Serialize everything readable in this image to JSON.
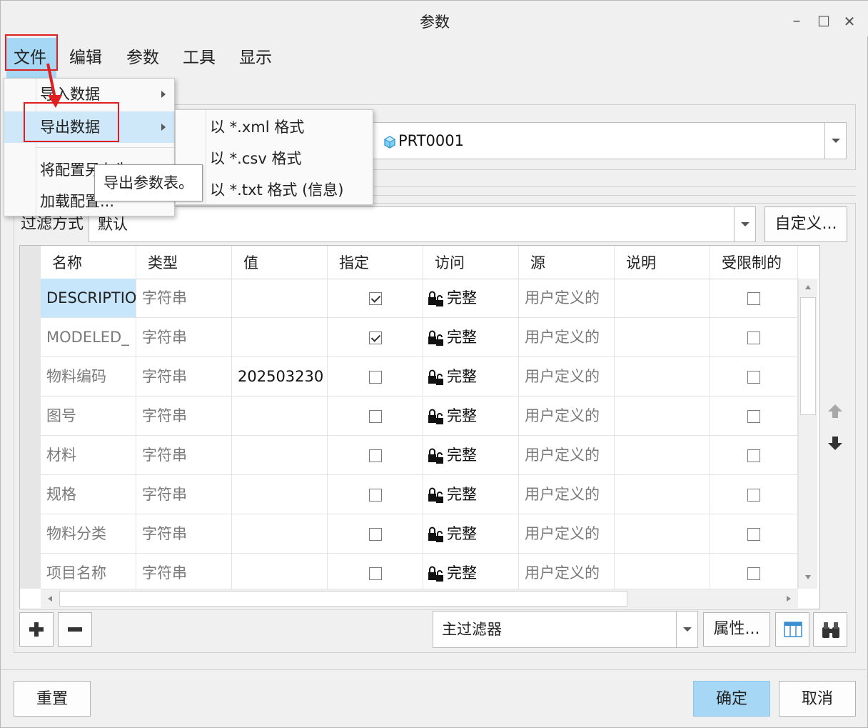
{
  "window": {
    "title": "参数",
    "minimize_glyph": "–",
    "maximize_glyph": "☐",
    "close_glyph": "✕"
  },
  "menubar": {
    "items": [
      "文件",
      "编辑",
      "参数",
      "工具",
      "显示"
    ]
  },
  "file_menu": {
    "items": [
      {
        "label": "导入数据",
        "submenu": true
      },
      {
        "label": "导出数据",
        "submenu": true
      },
      {
        "label": "将配置另存为",
        "submenu": false
      },
      {
        "label": "加载配置...",
        "submenu": false
      }
    ]
  },
  "export_submenu": {
    "items": [
      "以 *.xml 格式",
      "以 *.csv 格式",
      "以 *.txt 格式 (信息)"
    ]
  },
  "tooltip": "导出参数表。",
  "lookin": {
    "value": "PRT0001"
  },
  "filter": {
    "label": "过滤方式",
    "value": "默认",
    "customize_label": "自定义..."
  },
  "table": {
    "headers": [
      "名称",
      "类型",
      "值",
      "指定",
      "访问",
      "源",
      "说明",
      "受限制的"
    ],
    "rows": [
      {
        "name": "DESCRIPTIO",
        "type": "字符串",
        "value": "",
        "designate": true,
        "access": "完整",
        "source": "用户定义的",
        "description": "",
        "restricted": false
      },
      {
        "name": "MODELED_",
        "type": "字符串",
        "value": "",
        "designate": true,
        "access": "完整",
        "source": "用户定义的",
        "description": "",
        "restricted": false
      },
      {
        "name": "物料编码",
        "type": "字符串",
        "value": "202503230",
        "designate": false,
        "access": "完整",
        "source": "用户定义的",
        "description": "",
        "restricted": false
      },
      {
        "name": "图号",
        "type": "字符串",
        "value": "",
        "designate": false,
        "access": "完整",
        "source": "用户定义的",
        "description": "",
        "restricted": false
      },
      {
        "name": "材料",
        "type": "字符串",
        "value": "",
        "designate": false,
        "access": "完整",
        "source": "用户定义的",
        "description": "",
        "restricted": false
      },
      {
        "name": "规格",
        "type": "字符串",
        "value": "",
        "designate": false,
        "access": "完整",
        "source": "用户定义的",
        "description": "",
        "restricted": false
      },
      {
        "name": "物料分类",
        "type": "字符串",
        "value": "",
        "designate": false,
        "access": "完整",
        "source": "用户定义的",
        "description": "",
        "restricted": false
      },
      {
        "name": "项目名称",
        "type": "字符串",
        "value": "",
        "designate": false,
        "access": "完整",
        "source": "用户定义的",
        "description": "",
        "restricted": false
      }
    ]
  },
  "bottom_toolbar": {
    "main_filter": "主过滤器",
    "properties_label": "属性..."
  },
  "footer": {
    "reset_label": "重置",
    "ok_label": "确定",
    "cancel_label": "取消"
  },
  "colors": {
    "accent": "#a6d8f5",
    "highlight_red": "#e02020"
  }
}
